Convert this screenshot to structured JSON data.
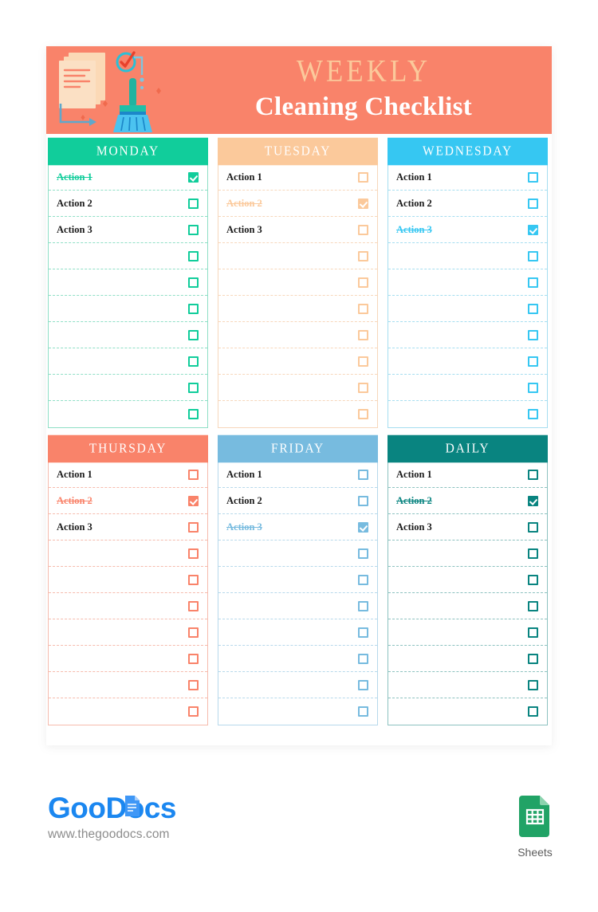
{
  "banner": {
    "title_top": "WEEKLY",
    "title_main": "Cleaning Checklist",
    "bg_color": "#F9836A",
    "title_top_color": "#FBC99B",
    "title_main_color": "#FFFFFF",
    "illustration": {
      "papers_icon": "stacked-documents",
      "check_icon": "checkmark-circle",
      "broom_icon": "broom",
      "arrow_icon": "corner-arrow"
    }
  },
  "columns": [
    {
      "day": "MONDAY",
      "header_color": "#11CD9B",
      "accent_color": "#11CD9B",
      "border_color": "#8FDFC6",
      "rows": [
        {
          "label": "Action 1",
          "checked": true
        },
        {
          "label": "Action 2",
          "checked": false
        },
        {
          "label": "Action 3",
          "checked": false
        },
        {
          "label": "",
          "checked": false
        },
        {
          "label": "",
          "checked": false
        },
        {
          "label": "",
          "checked": false
        },
        {
          "label": "",
          "checked": false
        },
        {
          "label": "",
          "checked": false
        },
        {
          "label": "",
          "checked": false
        },
        {
          "label": "",
          "checked": false
        }
      ]
    },
    {
      "day": "TUESDAY",
      "header_color": "#FBC99B",
      "accent_color": "#FBC99B",
      "border_color": "#F7D7BB",
      "rows": [
        {
          "label": "Action 1",
          "checked": false
        },
        {
          "label": "Action 2",
          "checked": true
        },
        {
          "label": "Action 3",
          "checked": false
        },
        {
          "label": "",
          "checked": false
        },
        {
          "label": "",
          "checked": false
        },
        {
          "label": "",
          "checked": false
        },
        {
          "label": "",
          "checked": false
        },
        {
          "label": "",
          "checked": false
        },
        {
          "label": "",
          "checked": false
        },
        {
          "label": "",
          "checked": false
        }
      ]
    },
    {
      "day": "WEDNESDAY",
      "header_color": "#36C7F2",
      "accent_color": "#36C7F2",
      "border_color": "#A6DEF0",
      "rows": [
        {
          "label": "Action 1",
          "checked": false
        },
        {
          "label": "Action 2",
          "checked": false
        },
        {
          "label": "Action 3",
          "checked": true
        },
        {
          "label": "",
          "checked": false
        },
        {
          "label": "",
          "checked": false
        },
        {
          "label": "",
          "checked": false
        },
        {
          "label": "",
          "checked": false
        },
        {
          "label": "",
          "checked": false
        },
        {
          "label": "",
          "checked": false
        },
        {
          "label": "",
          "checked": false
        }
      ]
    },
    {
      "day": "THURSDAY",
      "header_color": "#F9836A",
      "accent_color": "#F9836A",
      "border_color": "#F6BBAD",
      "rows": [
        {
          "label": "Action 1",
          "checked": false
        },
        {
          "label": "Action 2",
          "checked": true
        },
        {
          "label": "Action 3",
          "checked": false
        },
        {
          "label": "",
          "checked": false
        },
        {
          "label": "",
          "checked": false
        },
        {
          "label": "",
          "checked": false
        },
        {
          "label": "",
          "checked": false
        },
        {
          "label": "",
          "checked": false
        },
        {
          "label": "",
          "checked": false
        },
        {
          "label": "",
          "checked": false
        }
      ]
    },
    {
      "day": "FRIDAY",
      "header_color": "#77BBDF",
      "accent_color": "#77BBDF",
      "border_color": "#B7D9EB",
      "rows": [
        {
          "label": "Action 1",
          "checked": false
        },
        {
          "label": "Action 2",
          "checked": false
        },
        {
          "label": "Action 3",
          "checked": true
        },
        {
          "label": "",
          "checked": false
        },
        {
          "label": "",
          "checked": false
        },
        {
          "label": "",
          "checked": false
        },
        {
          "label": "",
          "checked": false
        },
        {
          "label": "",
          "checked": false
        },
        {
          "label": "",
          "checked": false
        },
        {
          "label": "",
          "checked": false
        }
      ]
    },
    {
      "day": "DAILY",
      "header_color": "#098480",
      "accent_color": "#098480",
      "border_color": "#8DC2C0",
      "rows": [
        {
          "label": "Action 1",
          "checked": false
        },
        {
          "label": "Action 2",
          "checked": true
        },
        {
          "label": "Action 3",
          "checked": false
        },
        {
          "label": "",
          "checked": false
        },
        {
          "label": "",
          "checked": false
        },
        {
          "label": "",
          "checked": false
        },
        {
          "label": "",
          "checked": false
        },
        {
          "label": "",
          "checked": false
        },
        {
          "label": "",
          "checked": false
        },
        {
          "label": "",
          "checked": false
        }
      ]
    }
  ],
  "footer": {
    "logo_text": "GooDocs",
    "logo_color": "#1B87F0",
    "url": "www.thegoodocs.com",
    "app_label": "Sheets",
    "app_icon": "google-sheets-icon",
    "app_color": "#21A366"
  }
}
